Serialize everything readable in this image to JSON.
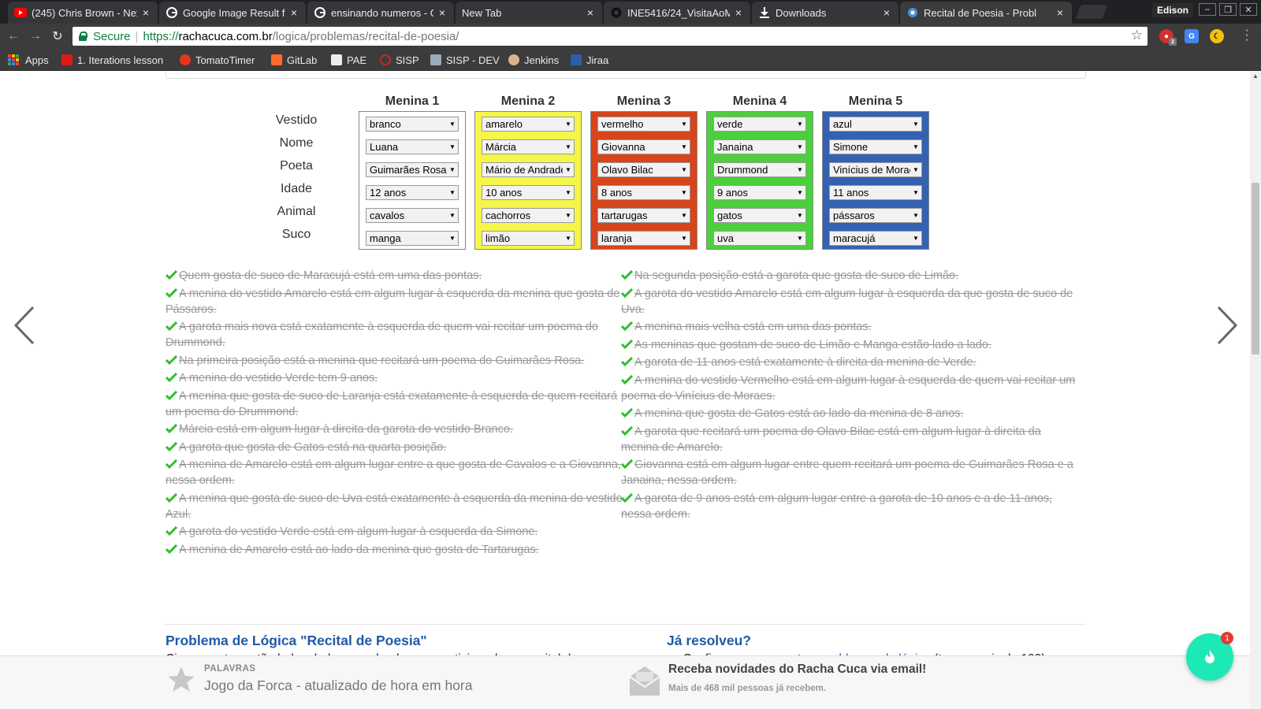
{
  "browser": {
    "tabs": [
      {
        "title": "(245) Chris Brown - Nex",
        "icon": "youtube-icon"
      },
      {
        "title": "Google Image Result fo",
        "icon": "google-icon"
      },
      {
        "title": "ensinando numeros - G",
        "icon": "google-icon"
      },
      {
        "title": "New Tab",
        "icon": ""
      },
      {
        "title": "INE5416/24_VisitaAoM",
        "icon": "github-icon"
      },
      {
        "title": "Downloads",
        "icon": "download-icon"
      },
      {
        "title": "Recital de Poesia - Probl",
        "icon": "rachacuca-icon"
      }
    ],
    "profile_name": "Edison",
    "secure_label": "Secure",
    "url": {
      "scheme": "https://",
      "host": "rachacuca.com.br",
      "path": "/logica/problemas/recital-de-poesia/"
    },
    "extensions": {
      "notif_count": "2"
    },
    "bookmarks": [
      {
        "label": "Apps",
        "icon": "apps-grid-icon"
      },
      {
        "label": "1. Iterations lesson",
        "icon": "angular-icon"
      },
      {
        "label": "TomatoTimer",
        "icon": "tomato-icon"
      },
      {
        "label": "GitLab",
        "icon": "gitlab-icon"
      },
      {
        "label": "PAE",
        "icon": "pae-icon"
      },
      {
        "label": "SISP",
        "icon": "sisp-icon"
      },
      {
        "label": "SISP - DEV",
        "icon": "sisp-dev-icon"
      },
      {
        "label": "Jenkins",
        "icon": "jenkins-icon"
      },
      {
        "label": "Jiraa",
        "icon": "jira-icon"
      }
    ]
  },
  "puzzle": {
    "row_labels": [
      "Vestido",
      "Nome",
      "Poeta",
      "Idade",
      "Animal",
      "Suco"
    ],
    "girls": [
      {
        "header": "Menina 1",
        "color": "#ffffff",
        "values": [
          "branco",
          "Luana",
          "Guimarães Rosa",
          "12 anos",
          "cavalos",
          "manga"
        ]
      },
      {
        "header": "Menina 2",
        "color": "#f5f54a",
        "values": [
          "amarelo",
          "Márcia",
          "Mário de Andrade",
          "10 anos",
          "cachorros",
          "limão"
        ]
      },
      {
        "header": "Menina 3",
        "color": "#d6451b",
        "values": [
          "vermelho",
          "Giovanna",
          "Olavo Bilac",
          "8 anos",
          "tartarugas",
          "laranja"
        ]
      },
      {
        "header": "Menina 4",
        "color": "#4bcf3c",
        "values": [
          "verde",
          "Janaina",
          "Drummond",
          "9 anos",
          "gatos",
          "uva"
        ]
      },
      {
        "header": "Menina 5",
        "color": "#3561b2",
        "values": [
          "azul",
          "Simone",
          "Vinícius de Moraes",
          "11 anos",
          "pássaros",
          "maracujá"
        ]
      }
    ]
  },
  "clues_left": [
    "Quem gosta de suco de Maracujá está em uma das pontas.",
    "A menina do vestido Amarelo está em algum lugar à esquerda da menina que gosta de Pássaros.",
    "A garota mais nova está exatamente à esquerda de quem vai recitar um poema do Drummond.",
    "Na primeira posição está a menina que recitará um poema do Guimarães Rosa.",
    "A menina do vestido Verde tem 9 anos.",
    "A menina que gosta de suco de Laranja está exatamente à esquerda de quem recitará um poema do Drummond.",
    "Márcia está em algum lugar à direita da garota do vestido Branco.",
    "A garota que gosta de Gatos está na quarta posição.",
    "A menina de Amarelo está em algum lugar entre a que gosta de Cavalos e a Giovanna, nessa ordem.",
    "A menina que gosta de suco de Uva está exatamente à esquerda da menina do vestido Azul.",
    "A garota do vestido Verde está em algum lugar à esquerda da Simone.",
    "A menina de Amarelo está ao lado da menina que gosta de Tartarugas."
  ],
  "clues_right": [
    "Na segunda posição está a garota que gosta de suco de Limão.",
    "A garota do vestido Amarelo está em algum lugar à esquerda da que gosta de suco de Uva.",
    "A menina mais velha está em uma das pontas.",
    "As meninas que gostam de suco de Limão e Manga estão lado a lado.",
    "A garota de 11 anos está exatamente à direita da menina de Verde.",
    "A menina do vestido Vermelho está em algum lugar à esquerda de quem vai recitar um poema do Vinícius de Moraes.",
    "A menina que gosta de Gatos está ao lado da menina de 8 anos.",
    "A garota que recitará um poema do Olavo Bilac está em algum lugar à direita da menina de Amarelo.",
    "Giovanna está em algum lugar entre quem recitará um poema de Guimarães Rosa e a Janaina, nessa ordem.",
    "A garota de 9 anos está em algum lugar entre a garota de 10 anos e a de 11 anos, nessa ordem."
  ],
  "info": {
    "problem_title": "Problema de Lógica \"Recital de Poesia\"",
    "problem_text": "Cinco garotas estão lado a lado aguardando para participar de um recital de",
    "solved_title": "Já resolveu?",
    "bullet_prefix": "Confira os nossos outros ",
    "bullet_link": "problemas de lógica",
    "bullet_suffix": " (temos mais de 100);"
  },
  "footer": {
    "kicker": "PALAVRAS",
    "game_text": "Jogo da Forca - atualizado de hora em hora",
    "newsletter_title": "Receba novidades do Racha Cuca via email!",
    "newsletter_sub": "Mais de 468 mil pessoas já recebem."
  },
  "fab": {
    "badge": "1"
  },
  "colors": {
    "accent_link": "#1f5aa6",
    "check": "#2fbf2f",
    "fab": "#1de9b6"
  }
}
